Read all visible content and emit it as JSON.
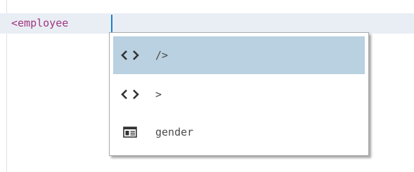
{
  "editor": {
    "line_text": "<employee "
  },
  "autocomplete": {
    "items": [
      {
        "label": "/>",
        "icon": "tag-brackets-icon",
        "selected": true
      },
      {
        "label": ">",
        "icon": "tag-brackets-icon",
        "selected": false
      },
      {
        "label": "gender",
        "icon": "attribute-icon",
        "selected": false
      }
    ]
  },
  "colors": {
    "tag_text": "#a0377e",
    "current_line_bg": "#e9eef5",
    "caret": "#1f7ec9",
    "selection_bg": "#b9d1e0"
  }
}
